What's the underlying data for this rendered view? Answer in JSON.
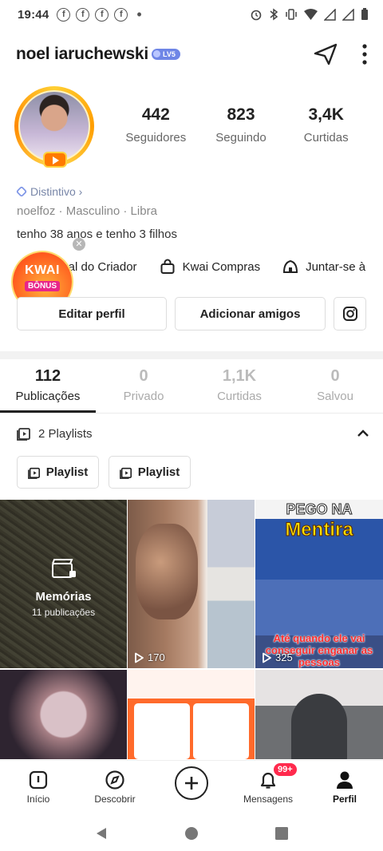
{
  "status_bar": {
    "time": "19:44",
    "fb_glyph": "f"
  },
  "profile": {
    "username": "noel iaruchewski",
    "level_badge": "LV5",
    "stats": [
      {
        "value": "442",
        "label": "Seguidores"
      },
      {
        "value": "823",
        "label": "Seguindo"
      },
      {
        "value": "3,4K",
        "label": "Curtidas"
      }
    ],
    "distintivo": "Distintivo",
    "meta": "noelfoz · Masculino · Libra",
    "bio": "tenho 38 anos e tenho 3 filhos"
  },
  "links": {
    "creator": "Central do Criador",
    "shop": "Kwai Compras",
    "join": "Juntar-se à"
  },
  "kwai_bonus": {
    "title": "KWAI",
    "subtitle": "BÔNUS"
  },
  "buttons": {
    "edit": "Editar perfil",
    "add_friends": "Adicionar amigos"
  },
  "tabs": [
    {
      "count": "112",
      "label": "Publicações"
    },
    {
      "count": "0",
      "label": "Privado"
    },
    {
      "count": "1,1K",
      "label": "Curtidas"
    },
    {
      "count": "0",
      "label": "Salvou"
    }
  ],
  "playlists": {
    "header": "2 Playlists",
    "items": [
      "Playlist",
      "Playlist"
    ]
  },
  "grid": {
    "memories_title": "Memórias",
    "memories_sub": "11 publicações",
    "v1": "170",
    "v2": "325",
    "thumb3_line1": "PEGO NA",
    "thumb3_line2": "Mentira",
    "thumb3_caption": "Até quando ele vai conseguir enganar as pessoas"
  },
  "bottom_nav": {
    "home": "Início",
    "discover": "Descobrir",
    "messages": "Mensagens",
    "messages_badge": "99+",
    "profile": "Perfil"
  },
  "colors": {
    "accent_orange": "#ff6a2b",
    "badge_red": "#ff2a4d",
    "level_blue": "#6f86e6"
  }
}
